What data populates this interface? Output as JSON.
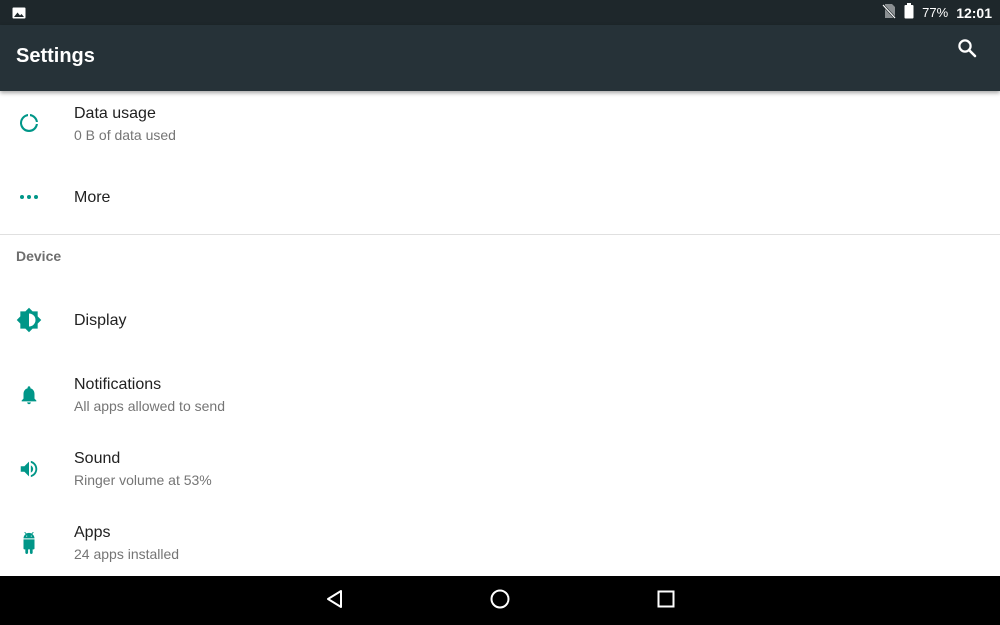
{
  "status_bar": {
    "battery": "77%",
    "time": "12:01",
    "icons": [
      "image-icon",
      "no-sim-icon",
      "battery-icon"
    ]
  },
  "app_bar": {
    "title": "Settings",
    "search_icon": "search-icon"
  },
  "items_top": [
    {
      "title": "Data usage",
      "subtitle": "0 B of data used",
      "icon": "data-usage-icon"
    },
    {
      "title": "More",
      "subtitle": "",
      "icon": "more-horiz-icon"
    }
  ],
  "device_header": "Device",
  "items_device": [
    {
      "title": "Display",
      "subtitle": "",
      "icon": "brightness-icon"
    },
    {
      "title": "Notifications",
      "subtitle": "All apps allowed to send",
      "icon": "bell-icon"
    },
    {
      "title": "Sound",
      "subtitle": "Ringer volume at 53%",
      "icon": "volume-icon"
    },
    {
      "title": "Apps",
      "subtitle": "24 apps installed",
      "icon": "android-icon"
    }
  ],
  "nav_bar": {
    "buttons": [
      "back-icon",
      "home-icon",
      "recents-icon"
    ]
  },
  "colors": {
    "accent": "#009688",
    "app_bar": "#263238",
    "status_bar": "#1e272b"
  }
}
